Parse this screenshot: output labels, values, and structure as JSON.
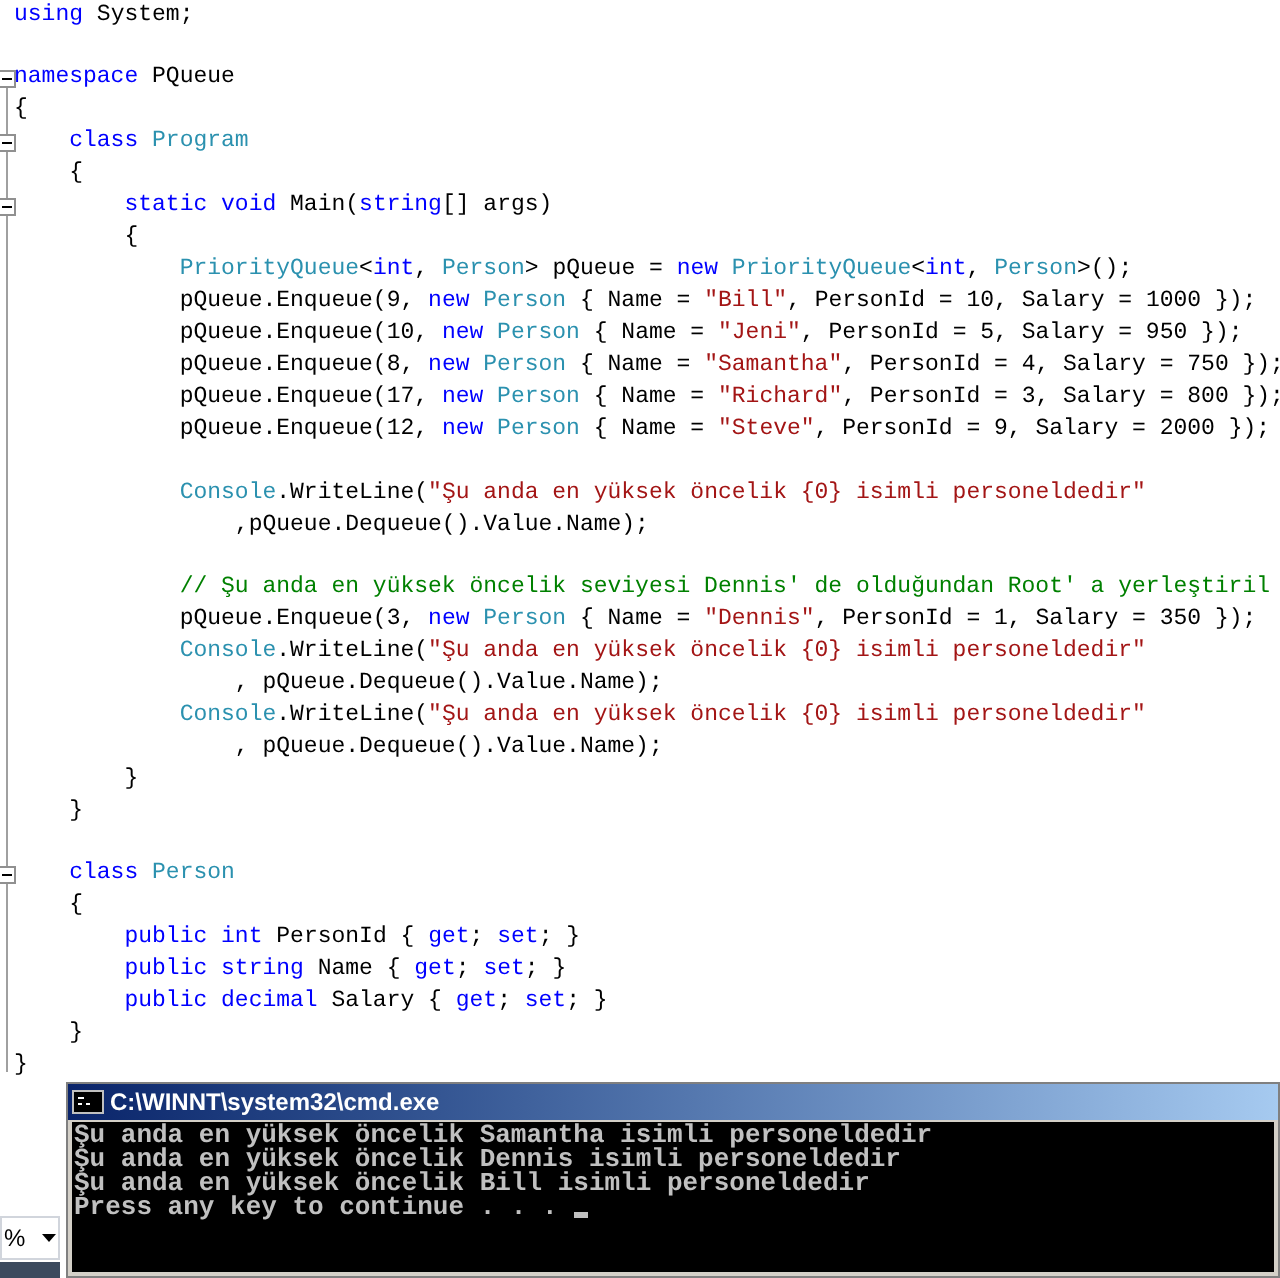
{
  "editor": {
    "lines": [
      {
        "kind": "code",
        "tokens": [
          {
            "kind": "kw",
            "text": "using"
          },
          {
            "kind": "plain",
            "text": " System;"
          }
        ]
      },
      {
        "kind": "blank"
      },
      {
        "kind": "code",
        "expanded": true,
        "tokens": [
          {
            "kind": "kw",
            "text": "namespace"
          },
          {
            "kind": "plain",
            "text": " PQueue"
          }
        ]
      },
      {
        "kind": "code",
        "tokens": [
          {
            "kind": "plain",
            "text": "{"
          }
        ]
      },
      {
        "kind": "code",
        "expanded": true,
        "tokens": [
          {
            "kind": "kw",
            "text": "    class "
          },
          {
            "kind": "type",
            "text": "Program"
          }
        ]
      },
      {
        "kind": "code",
        "tokens": [
          {
            "kind": "plain",
            "text": "    {"
          }
        ]
      },
      {
        "kind": "code",
        "expanded": true,
        "tokens": [
          {
            "kind": "kw",
            "text": "        static void"
          },
          {
            "kind": "plain",
            "text": " Main("
          },
          {
            "kind": "kw",
            "text": "string"
          },
          {
            "kind": "plain",
            "text": "[] args)"
          }
        ]
      },
      {
        "kind": "code",
        "tokens": [
          {
            "kind": "plain",
            "text": "        {"
          }
        ]
      },
      {
        "kind": "code",
        "tokens": [
          {
            "kind": "type",
            "text": "            PriorityQueue"
          },
          {
            "kind": "plain",
            "text": "<"
          },
          {
            "kind": "kw",
            "text": "int"
          },
          {
            "kind": "plain",
            "text": ", "
          },
          {
            "kind": "type",
            "text": "Person"
          },
          {
            "kind": "plain",
            "text": "> pQueue = "
          },
          {
            "kind": "kw",
            "text": "new "
          },
          {
            "kind": "type",
            "text": "PriorityQueue"
          },
          {
            "kind": "plain",
            "text": "<"
          },
          {
            "kind": "kw",
            "text": "int"
          },
          {
            "kind": "plain",
            "text": ", "
          },
          {
            "kind": "type",
            "text": "Person"
          },
          {
            "kind": "plain",
            "text": ">();"
          }
        ]
      },
      {
        "kind": "code",
        "tokens": [
          {
            "kind": "plain",
            "text": "            pQueue.Enqueue(9, "
          },
          {
            "kind": "kw",
            "text": "new "
          },
          {
            "kind": "type",
            "text": "Person"
          },
          {
            "kind": "plain",
            "text": " { Name = "
          },
          {
            "kind": "str",
            "text": "\"Bill\""
          },
          {
            "kind": "plain",
            "text": ", PersonId = 10, Salary = 1000 });"
          }
        ]
      },
      {
        "kind": "code",
        "tokens": [
          {
            "kind": "plain",
            "text": "            pQueue.Enqueue(10, "
          },
          {
            "kind": "kw",
            "text": "new "
          },
          {
            "kind": "type",
            "text": "Person"
          },
          {
            "kind": "plain",
            "text": " { Name = "
          },
          {
            "kind": "str",
            "text": "\"Jeni\""
          },
          {
            "kind": "plain",
            "text": ", PersonId = 5, Salary = 950 });"
          }
        ]
      },
      {
        "kind": "code",
        "tokens": [
          {
            "kind": "plain",
            "text": "            pQueue.Enqueue(8, "
          },
          {
            "kind": "kw",
            "text": "new "
          },
          {
            "kind": "type",
            "text": "Person"
          },
          {
            "kind": "plain",
            "text": " { Name = "
          },
          {
            "kind": "str",
            "text": "\"Samantha\""
          },
          {
            "kind": "plain",
            "text": ", PersonId = 4, Salary = 750 });"
          }
        ]
      },
      {
        "kind": "code",
        "tokens": [
          {
            "kind": "plain",
            "text": "            pQueue.Enqueue(17, "
          },
          {
            "kind": "kw",
            "text": "new "
          },
          {
            "kind": "type",
            "text": "Person"
          },
          {
            "kind": "plain",
            "text": " { Name = "
          },
          {
            "kind": "str",
            "text": "\"Richard\""
          },
          {
            "kind": "plain",
            "text": ", PersonId = 3, Salary = 800 });"
          }
        ]
      },
      {
        "kind": "code",
        "tokens": [
          {
            "kind": "plain",
            "text": "            pQueue.Enqueue(12, "
          },
          {
            "kind": "kw",
            "text": "new "
          },
          {
            "kind": "type",
            "text": "Person"
          },
          {
            "kind": "plain",
            "text": " { Name = "
          },
          {
            "kind": "str",
            "text": "\"Steve\""
          },
          {
            "kind": "plain",
            "text": ", PersonId = 9, Salary = 2000 });"
          }
        ]
      },
      {
        "kind": "blank"
      },
      {
        "kind": "code",
        "tokens": [
          {
            "kind": "type",
            "text": "            Console"
          },
          {
            "kind": "plain",
            "text": ".WriteLine("
          },
          {
            "kind": "str",
            "text": "\"Şu anda en yüksek öncelik {0} isimli personeldedir\""
          }
        ]
      },
      {
        "kind": "code",
        "tokens": [
          {
            "kind": "plain",
            "text": "                ,pQueue.Dequeue().Value.Name);"
          }
        ]
      },
      {
        "kind": "blank"
      },
      {
        "kind": "code",
        "tokens": [
          {
            "kind": "comment",
            "text": "            // Şu anda en yüksek öncelik seviyesi Dennis' de olduğundan Root' a yerleştiril"
          }
        ]
      },
      {
        "kind": "code",
        "tokens": [
          {
            "kind": "plain",
            "text": "            pQueue.Enqueue(3, "
          },
          {
            "kind": "kw",
            "text": "new "
          },
          {
            "kind": "type",
            "text": "Person"
          },
          {
            "kind": "plain",
            "text": " { Name = "
          },
          {
            "kind": "str",
            "text": "\"Dennis\""
          },
          {
            "kind": "plain",
            "text": ", PersonId = 1, Salary = 350 });"
          }
        ]
      },
      {
        "kind": "code",
        "tokens": [
          {
            "kind": "type",
            "text": "            Console"
          },
          {
            "kind": "plain",
            "text": ".WriteLine("
          },
          {
            "kind": "str",
            "text": "\"Şu anda en yüksek öncelik {0} isimli personeldedir\""
          }
        ]
      },
      {
        "kind": "code",
        "tokens": [
          {
            "kind": "plain",
            "text": "                , pQueue.Dequeue().Value.Name);"
          }
        ]
      },
      {
        "kind": "code",
        "tokens": [
          {
            "kind": "type",
            "text": "            Console"
          },
          {
            "kind": "plain",
            "text": ".WriteLine("
          },
          {
            "kind": "str",
            "text": "\"Şu anda en yüksek öncelik {0} isimli personeldedir\""
          }
        ]
      },
      {
        "kind": "code",
        "tokens": [
          {
            "kind": "plain",
            "text": "                , pQueue.Dequeue().Value.Name);"
          }
        ]
      },
      {
        "kind": "code",
        "tokens": [
          {
            "kind": "plain",
            "text": "        }"
          }
        ]
      },
      {
        "kind": "code",
        "tokens": [
          {
            "kind": "plain",
            "text": "    }"
          }
        ]
      },
      {
        "kind": "blank"
      },
      {
        "kind": "code",
        "expanded": true,
        "tokens": [
          {
            "kind": "kw",
            "text": "    class "
          },
          {
            "kind": "type",
            "text": "Person"
          }
        ]
      },
      {
        "kind": "code",
        "tokens": [
          {
            "kind": "plain",
            "text": "    {"
          }
        ]
      },
      {
        "kind": "code",
        "tokens": [
          {
            "kind": "kw",
            "text": "        public int"
          },
          {
            "kind": "plain",
            "text": " PersonId { "
          },
          {
            "kind": "kw",
            "text": "get"
          },
          {
            "kind": "plain",
            "text": "; "
          },
          {
            "kind": "kw",
            "text": "set"
          },
          {
            "kind": "plain",
            "text": "; }"
          }
        ]
      },
      {
        "kind": "code",
        "tokens": [
          {
            "kind": "kw",
            "text": "        public string"
          },
          {
            "kind": "plain",
            "text": " Name { "
          },
          {
            "kind": "kw",
            "text": "get"
          },
          {
            "kind": "plain",
            "text": "; "
          },
          {
            "kind": "kw",
            "text": "set"
          },
          {
            "kind": "plain",
            "text": "; }"
          }
        ]
      },
      {
        "kind": "code",
        "tokens": [
          {
            "kind": "kw",
            "text": "        public decimal"
          },
          {
            "kind": "plain",
            "text": " Salary { "
          },
          {
            "kind": "kw",
            "text": "get"
          },
          {
            "kind": "plain",
            "text": "; "
          },
          {
            "kind": "kw",
            "text": "set"
          },
          {
            "kind": "plain",
            "text": "; }"
          }
        ]
      },
      {
        "kind": "code",
        "tokens": [
          {
            "kind": "plain",
            "text": "    }"
          }
        ]
      },
      {
        "kind": "code",
        "tokens": [
          {
            "kind": "plain",
            "text": "}"
          }
        ]
      }
    ]
  },
  "zoom_dropdown": {
    "value": "%"
  },
  "console_window": {
    "title": "C:\\WINNT\\system32\\cmd.exe",
    "lines": [
      "Şu anda en yüksek öncelik Samantha isimli personeldedir",
      "Şu anda en yüksek öncelik Dennis isimli personeldedir",
      "Şu anda en yüksek öncelik Bill isimli personeldedir",
      "Press any key to continue . . . "
    ]
  }
}
